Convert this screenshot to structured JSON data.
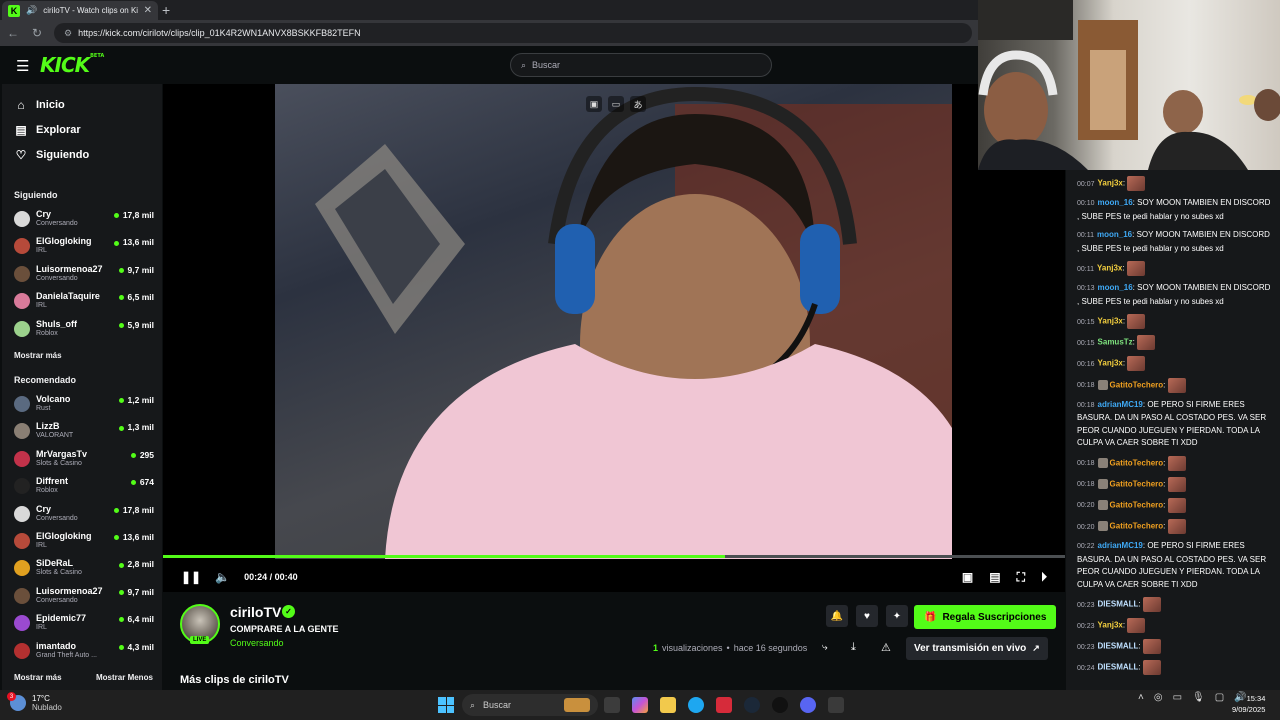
{
  "browser": {
    "tab_title": "ciriloTV - Watch clips on Kick",
    "favicon": "K",
    "url": "https://kick.com/cirilotv/clips/clip_01K4R2WN1ANVX8BSKKFB82TEFN"
  },
  "kick": {
    "logo": "KICK",
    "logo_sup": "BETA",
    "search_placeholder": "Buscar"
  },
  "sidebar": {
    "nav": [
      {
        "label": "Inicio",
        "icon": "home-icon"
      },
      {
        "label": "Explorar",
        "icon": "compass-icon"
      },
      {
        "label": "Siguiendo",
        "icon": "heart-icon"
      }
    ],
    "following_title": "Siguiendo",
    "following": [
      {
        "name": "Cry",
        "category": "Conversando",
        "viewers": "17,8 mil",
        "color": "#d9d9d9"
      },
      {
        "name": "ElGlogloking",
        "category": "IRL",
        "viewers": "13,6 mil",
        "color": "#b64a3a"
      },
      {
        "name": "Luisormenoa27",
        "category": "Conversando",
        "viewers": "9,7 mil",
        "color": "#6a4f3b"
      },
      {
        "name": "DanielaTaquire",
        "category": "IRL",
        "viewers": "6,5 mil",
        "color": "#d87a9a"
      },
      {
        "name": "Shuls_off",
        "category": "Roblox",
        "viewers": "5,9 mil",
        "color": "#9bd18c"
      }
    ],
    "show_more": "Mostrar más",
    "recommended_title": "Recomendado",
    "recommended": [
      {
        "name": "Volcano",
        "category": "Rust",
        "viewers": "1,2 mil",
        "color": "#5a6a80"
      },
      {
        "name": "LizzB",
        "category": "VALORANT",
        "viewers": "1,3 mil",
        "color": "#8a7f74"
      },
      {
        "name": "MrVargasTv",
        "category": "Slots & Casino",
        "viewers": "295",
        "color": "#c2324a"
      },
      {
        "name": "Diffrent",
        "category": "Roblox",
        "viewers": "674",
        "color": "#222222"
      },
      {
        "name": "Cry",
        "category": "Conversando",
        "viewers": "17,8 mil",
        "color": "#d9d9d9"
      },
      {
        "name": "ElGlogloking",
        "category": "IRL",
        "viewers": "13,6 mil",
        "color": "#b64a3a"
      },
      {
        "name": "SiDeRaL",
        "category": "Slots & Casino",
        "viewers": "2,8 mil",
        "color": "#e0a020"
      },
      {
        "name": "Luisormenoa27",
        "category": "Conversando",
        "viewers": "9,7 mil",
        "color": "#6a4f3b"
      },
      {
        "name": "Epidemic77",
        "category": "IRL",
        "viewers": "6,4 mil",
        "color": "#9a4ad0"
      },
      {
        "name": "imantado",
        "category": "Grand Theft Auto ...",
        "viewers": "4,3 mil",
        "color": "#b33030"
      }
    ],
    "show_more_bottom": "Mostrar más",
    "show_less": "Mostrar Menos"
  },
  "player": {
    "current_time": "00:24",
    "duration": "00:40",
    "time_display": "00:24 / 00:40",
    "progress": 0.623
  },
  "clip": {
    "channel": "ciriloTV",
    "live_badge": "LIVE",
    "title": "COMPRARE A LA GENTE",
    "category": "Conversando",
    "views_count": "1",
    "views_label": "visualizaciones",
    "separator": "•",
    "age": "hace 16 segundos",
    "gift_button": "Regala Suscripciones",
    "watch_live": "Ver transmisión en vivo",
    "more_clips": "Más clips de ciriloTV"
  },
  "chat": [
    {
      "time": "00:07",
      "user": "Yanj3x",
      "color": "#f4d03f",
      "text": "",
      "emote": true,
      "badge": false
    },
    {
      "time": "00:10",
      "user": "moon_16",
      "color": "#3fa9f5",
      "text": "SOY MOON TAMBIEN EN DISCORD , SUBE PES te pedi hablar y no subes xd",
      "emote": false,
      "badge": false
    },
    {
      "time": "00:11",
      "user": "moon_16",
      "color": "#3fa9f5",
      "text": "SOY MOON TAMBIEN EN DISCORD , SUBE PES te pedi hablar y no subes xd",
      "emote": false,
      "badge": false
    },
    {
      "time": "00:11",
      "user": "Yanj3x",
      "color": "#f4d03f",
      "text": "",
      "emote": true,
      "badge": false
    },
    {
      "time": "00:13",
      "user": "moon_16",
      "color": "#3fa9f5",
      "text": "SOY MOON TAMBIEN EN DISCORD , SUBE PES te pedi hablar y no subes xd",
      "emote": false,
      "badge": false
    },
    {
      "time": "00:15",
      "user": "Yanj3x",
      "color": "#f4d03f",
      "text": "",
      "emote": true,
      "badge": false
    },
    {
      "time": "00:15",
      "user": "SamusTz",
      "color": "#7ee37e",
      "text": "",
      "emote": true,
      "badge": false
    },
    {
      "time": "00:16",
      "user": "Yanj3x",
      "color": "#f4d03f",
      "text": "",
      "emote": true,
      "badge": false
    },
    {
      "time": "00:18",
      "user": "GatitoTechero",
      "color": "#f0a020",
      "text": "",
      "emote": true,
      "badge": true
    },
    {
      "time": "00:18",
      "user": "adrianMC19",
      "color": "#3fa9f5",
      "text": "OE PERO SI FIRME ERES BASURA. DA UN PASO AL COSTADO PES. VA SER PEOR CUANDO JUEGUEN Y PIERDAN. TODA LA CULPA VA CAER SOBRE TI XDD",
      "emote": false,
      "badge": false
    },
    {
      "time": "00:18",
      "user": "GatitoTechero",
      "color": "#f0a020",
      "text": "",
      "emote": true,
      "badge": true
    },
    {
      "time": "00:18",
      "user": "GatitoTechero",
      "color": "#f0a020",
      "text": "",
      "emote": true,
      "badge": true
    },
    {
      "time": "00:20",
      "user": "GatitoTechero",
      "color": "#f0a020",
      "text": "",
      "emote": true,
      "badge": true
    },
    {
      "time": "00:20",
      "user": "GatitoTechero",
      "color": "#f0a020",
      "text": "",
      "emote": true,
      "badge": true
    },
    {
      "time": "00:22",
      "user": "adrianMC19",
      "color": "#3fa9f5",
      "text": "OE PERO SI FIRME ERES BASURA. DA UN PASO AL COSTADO PES. VA SER PEOR CUANDO JUEGUEN Y PIERDAN. TODA LA CULPA VA CAER SOBRE TI XDD",
      "emote": false,
      "badge": false
    },
    {
      "time": "00:23",
      "user": "DIESMALL",
      "color": "#bfe0ff",
      "text": "",
      "emote": true,
      "badge": false
    },
    {
      "time": "00:23",
      "user": "Yanj3x",
      "color": "#f4d03f",
      "text": "",
      "emote": true,
      "badge": false
    },
    {
      "time": "00:23",
      "user": "DIESMALL",
      "color": "#bfe0ff",
      "text": "",
      "emote": true,
      "badge": false
    },
    {
      "time": "00:24",
      "user": "DIESMALL",
      "color": "#bfe0ff",
      "text": "",
      "emote": true,
      "badge": false
    }
  ],
  "taskbar": {
    "temperature": "17°C",
    "condition": "Nublado",
    "alert_count": "3",
    "search_placeholder": "Buscar",
    "time": "15:34",
    "date": "9/09/2025"
  },
  "colors": {
    "accent": "#53fc18",
    "background": "#0b0e0f",
    "panel": "#16181a"
  }
}
